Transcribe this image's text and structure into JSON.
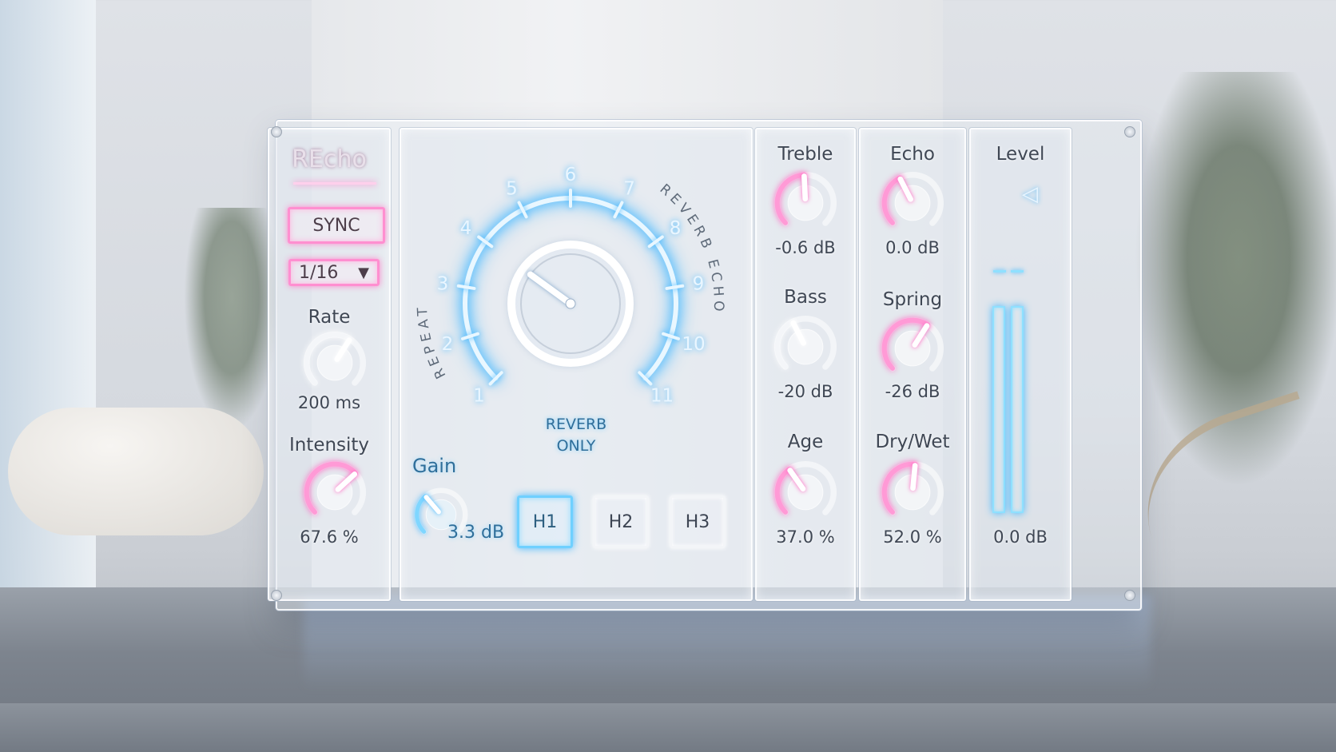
{
  "brand": {
    "title": "REcho"
  },
  "left": {
    "sync_label": "SYNC",
    "division": {
      "value": "1/16",
      "arrow": "▼"
    },
    "rate": {
      "label": "Rate",
      "value": "200 ms",
      "level": 0.62
    },
    "intensity": {
      "label": "Intensity",
      "value": "67.6 %",
      "level": 0.676
    }
  },
  "center": {
    "mode_dial": {
      "ticks": [
        "1",
        "2",
        "3",
        "4",
        "5",
        "6",
        "7",
        "8",
        "9",
        "10",
        "11"
      ],
      "arc_label_left": "REPEAT",
      "arc_label_right": "REVERB ECHO",
      "level": 0.3
    },
    "mode_caption_line1": "REVERB",
    "mode_caption_line2": "ONLY",
    "gain": {
      "label": "Gain",
      "value": "3.3 dB",
      "level": 0.35
    },
    "heads": [
      {
        "label": "H1",
        "active": true
      },
      {
        "label": "H2",
        "active": false
      },
      {
        "label": "H3",
        "active": false
      }
    ]
  },
  "eq": {
    "treble": {
      "label": "Treble",
      "value": "-0.6 dB",
      "level": 0.49
    },
    "bass": {
      "label": "Bass",
      "value": "-20 dB",
      "level": 0.4
    },
    "age": {
      "label": "Age",
      "value": "37.0 %",
      "level": 0.37
    }
  },
  "fx": {
    "echo": {
      "label": "Echo",
      "value": "0.0 dB",
      "level": 0.4
    },
    "spring": {
      "label": "Spring",
      "value": "-26 dB",
      "level": 0.62
    },
    "drywet": {
      "label": "Dry/Wet",
      "value": "52.0 %",
      "level": 0.52
    }
  },
  "level": {
    "label": "Level",
    "value": "0.0 dB",
    "arrow": "◁",
    "meter_left": 0.88,
    "meter_right": 0.88
  },
  "colors": {
    "pink": "#ff86cc",
    "blue": "#49bfff",
    "white": "#f4f6f9"
  }
}
